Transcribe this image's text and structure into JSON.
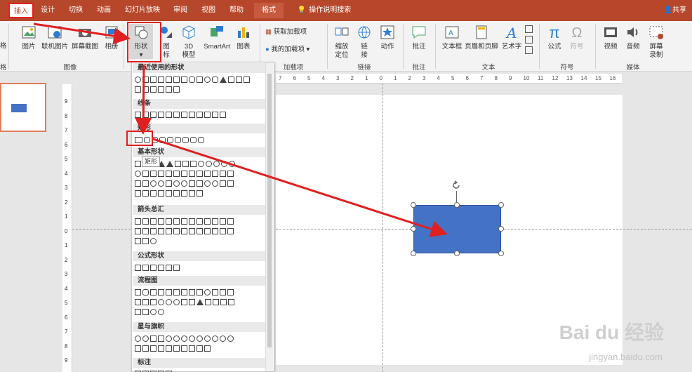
{
  "tabs": [
    {
      "label": "插入",
      "active": true
    },
    {
      "label": "设计"
    },
    {
      "label": "切换"
    },
    {
      "label": "动画"
    },
    {
      "label": "幻灯片放映"
    },
    {
      "label": "审阅"
    },
    {
      "label": "视图"
    },
    {
      "label": "帮助"
    },
    {
      "label": "格式"
    },
    {
      "label": "操作说明搜索"
    }
  ],
  "share_label": "共享",
  "ribbon": {
    "partial_left_a": "格",
    "partial_left_b": "格",
    "images_group": {
      "picture": "图片",
      "online_picture": "联机图片",
      "screenshot": "屏幕截图",
      "album": "相册",
      "group_label": "图像"
    },
    "shapes_button": "形状",
    "icons": "图标",
    "model_3d": "3D 模型",
    "smartart": "SmartArt",
    "chart": "图表",
    "addins": {
      "get": "获取加载项",
      "mine": "我的加载项",
      "group_label": "加载项"
    },
    "links": {
      "zoom": "缩放定位",
      "link": "链接",
      "action": "动作",
      "group_label": "链接"
    },
    "comment": "批注",
    "comment_group": "批注",
    "text": {
      "textbox": "文本框",
      "header_footer": "页眉和页脚",
      "wordart": "艺术字",
      "group_label": "文本"
    },
    "symbols": {
      "equation": "公式",
      "symbol": "符号",
      "group_label": "符号"
    },
    "media": {
      "video": "视频",
      "audio": "音频",
      "screen_record": "屏幕录制",
      "group_label": "媒体"
    }
  },
  "shapes_menu": {
    "recent": "最近使用的形状",
    "lines": "线条",
    "rectangles": "矩形",
    "basic": "基本形状",
    "arrows": "箭头总汇",
    "equation": "公式形状",
    "flowchart": "流程图",
    "stars": "星与旗帜",
    "callouts": "标注",
    "tooltip": "矩形"
  },
  "ruler": {
    "h_ticks": [
      "7",
      "6",
      "5",
      "4",
      "3",
      "2",
      "1",
      "0",
      "1",
      "2",
      "3",
      "4",
      "5",
      "6",
      "7",
      "8",
      "9",
      "10",
      "11",
      "12",
      "13",
      "14",
      "15",
      "16"
    ],
    "v_ticks": [
      "9",
      "8",
      "7",
      "6",
      "5",
      "4",
      "3",
      "2",
      "1",
      "0",
      "1",
      "2",
      "3",
      "4",
      "5",
      "6",
      "7",
      "8",
      "9"
    ]
  },
  "watermark": {
    "brand": "Bai du 经验",
    "url": "jingyan.baidu.com"
  },
  "colors": {
    "accent": "#b7472a",
    "shape_fill": "#4472c4",
    "highlight": "#e02020"
  }
}
